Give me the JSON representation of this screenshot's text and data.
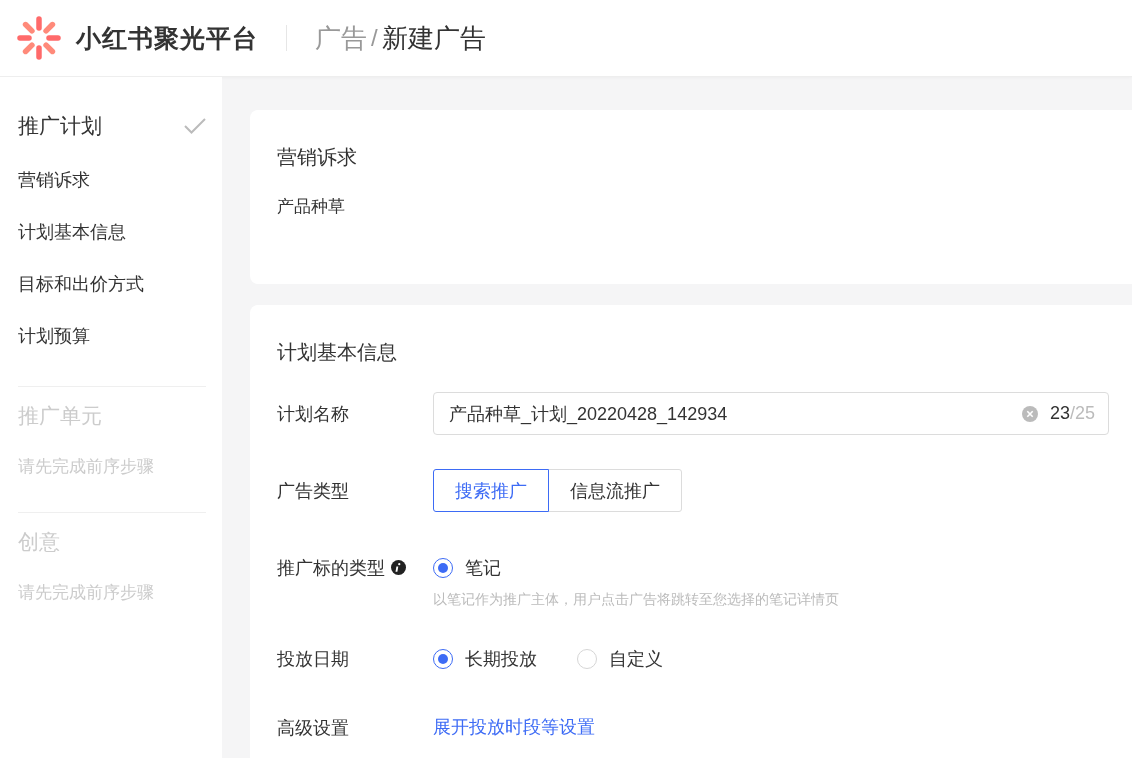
{
  "header": {
    "brand": "小红书聚光平台",
    "breadcrumb": [
      {
        "label": "广告",
        "current": false
      },
      {
        "label": "新建广告",
        "current": true
      }
    ],
    "separator": "/"
  },
  "sidebar": {
    "steps": [
      {
        "title": "推广计划",
        "completed": true,
        "disabled": false,
        "items": [
          "营销诉求",
          "计划基本信息",
          "目标和出价方式",
          "计划预算"
        ]
      },
      {
        "title": "推广单元",
        "completed": false,
        "disabled": true,
        "hint": "请先完成前序步骤"
      },
      {
        "title": "创意",
        "completed": false,
        "disabled": true,
        "hint": "请先完成前序步骤"
      }
    ]
  },
  "cards": [
    {
      "title": "营销诉求",
      "rows": [
        {
          "kind": "text",
          "value": "产品种草"
        }
      ]
    },
    {
      "title": "计划基本信息",
      "rows": [
        {
          "kind": "input",
          "label": "计划名称",
          "value": "产品种草_计划_20220428_142934",
          "count": "23",
          "max": "/25"
        },
        {
          "kind": "segmented",
          "label": "广告类型",
          "options": [
            {
              "label": "搜索推广",
              "selected": true
            },
            {
              "label": "信息流推广",
              "selected": false
            }
          ]
        },
        {
          "kind": "radio",
          "label": "推广标的类型",
          "info": true,
          "options": [
            {
              "label": "笔记",
              "selected": true
            }
          ],
          "hint": "以笔记作为推广主体，用户点击广告将跳转至您选择的笔记详情页"
        },
        {
          "kind": "radio",
          "label": "投放日期",
          "info": false,
          "options": [
            {
              "label": "长期投放",
              "selected": true
            },
            {
              "label": "自定义",
              "selected": false
            }
          ]
        },
        {
          "kind": "link",
          "label": "高级设置",
          "value": "展开投放时段等设置"
        }
      ]
    }
  ]
}
